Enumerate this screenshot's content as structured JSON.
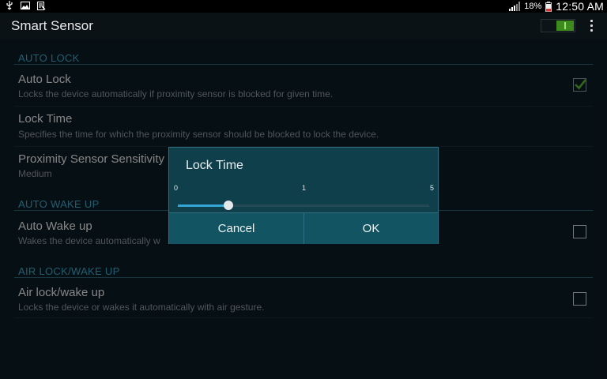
{
  "status_bar": {
    "icons_left": [
      "usb-icon",
      "image-icon",
      "clipboard-icon"
    ],
    "battery_percent": "18%",
    "time": "12:50 AM"
  },
  "action_bar": {
    "title": "Smart Sensor",
    "master_switch_on": true
  },
  "sections": {
    "auto_lock": "AUTO LOCK",
    "auto_wake": "AUTO WAKE UP",
    "air": "AIR LOCK/WAKE UP"
  },
  "items": {
    "auto_lock": {
      "title": "Auto Lock",
      "summary": "Locks the device automatically if proximity sensor is blocked for given time.",
      "checked": true
    },
    "lock_time": {
      "title": "Lock Time",
      "summary": "Specifies the time for which the proximity sensor should be blocked to lock the device."
    },
    "proximity": {
      "title": "Proximity Sensor Sensitivity",
      "summary": "Medium"
    },
    "auto_wake": {
      "title": "Auto Wake up",
      "summary": "Wakes the device automatically w",
      "checked": false
    },
    "air_lock": {
      "title": "Air lock/wake up",
      "summary": "Locks the device or wakes it automatically with air gesture.",
      "checked": false
    }
  },
  "dialog": {
    "title": "Lock Time",
    "slider": {
      "min": "0",
      "max": "5",
      "current": "1",
      "value": 1
    },
    "cancel_label": "Cancel",
    "ok_label": "OK"
  },
  "colors": {
    "accent": "#33a6d6",
    "section_header": "#3aa3c3",
    "dialog_bg": "#0f3f4b",
    "switch_on": "#3d8b1d"
  }
}
